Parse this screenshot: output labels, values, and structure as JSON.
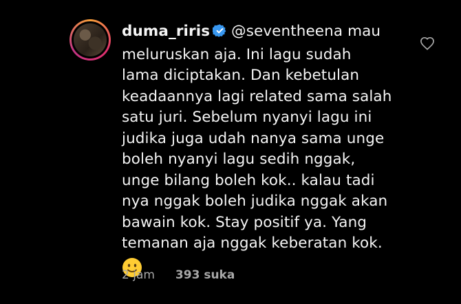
{
  "comment": {
    "username": "duma_riris",
    "lines": [
      "@seventheena mau",
      "meluruskan aja. Ini lagu sudah",
      "lama diciptakan. Dan kebetulan",
      "keadaannya lagi related sama salah",
      "satu juri. Sebelum nyanyi lagu ini",
      "judika juga udah nanya sama unge",
      "boleh nyanyi lagu sedih nggak,",
      "unge bilang boleh kok.. kalau tadi",
      "nya nggak boleh judika nggak akan",
      "bawain kok. Stay positif ya. Yang",
      "temanan aja nggak keberatan kok."
    ],
    "emoji": "slightly-smiling-face-emoji",
    "time": "2 jam",
    "likes": "393 suka"
  },
  "icons": {
    "verified": "verified-badge-icon",
    "like": "heart-icon"
  },
  "colors": {
    "background": "#000000",
    "text": "#f5f5f5",
    "muted": "#a8a8a8",
    "verified": "#3897f0",
    "emoji": "#ffcc33"
  }
}
